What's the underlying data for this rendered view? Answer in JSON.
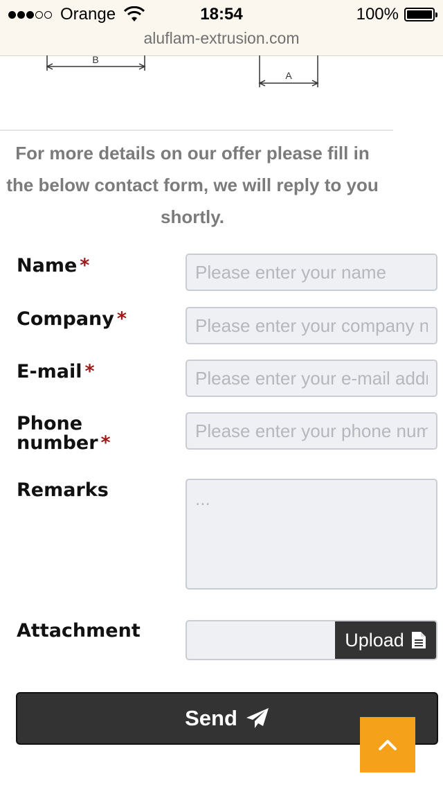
{
  "status_bar": {
    "carrier": "Orange",
    "time": "18:54",
    "battery": "100%",
    "url": "aluflam-extrusion.com"
  },
  "drawing": {
    "dim_b": "B",
    "dim_a": "A"
  },
  "intro": {
    "text": "For more details on our offer please fill in the below contact form, we will reply to you shortly."
  },
  "form": {
    "required_mark": "*",
    "name": {
      "label": "Name",
      "placeholder": "Please enter your name"
    },
    "company": {
      "label": "Company",
      "placeholder": "Please enter your company name"
    },
    "email": {
      "label": "E-mail",
      "placeholder": "Please enter your e-mail address"
    },
    "phone": {
      "label_line1": "Phone",
      "label_line2": "number",
      "placeholder": "Please enter your phone number"
    },
    "remarks": {
      "label": "Remarks",
      "placeholder": "..."
    },
    "attachment": {
      "label": "Attachment",
      "button_label": "Upload"
    },
    "send_label": "Send"
  },
  "colors": {
    "accent_orange": "#f6a11a",
    "button_dark": "#333333",
    "required_red": "#9c1a1a"
  },
  "icons": {
    "upload": "document-icon",
    "send": "paper-plane-icon",
    "back_to_top": "chevron-up-icon"
  }
}
